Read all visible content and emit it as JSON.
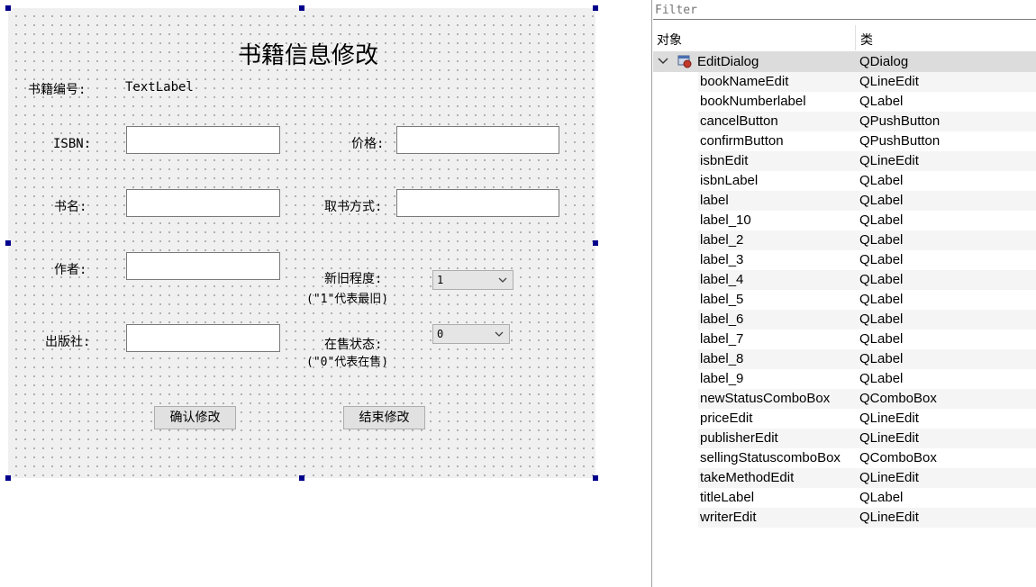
{
  "form": {
    "title": "书籍信息修改",
    "book_number_label": "书籍编号:",
    "book_number_value": "TextLabel",
    "isbn_label": "ISBN:",
    "price_label": "价格:",
    "book_name_label": "书名:",
    "take_method_label": "取书方式:",
    "writer_label": "作者:",
    "condition_label": "新旧程度:",
    "condition_hint": "(\"1\"代表最旧)",
    "condition_value": "1",
    "publisher_label": "出版社:",
    "selling_label": "在售状态:",
    "selling_hint": "(\"0\"代表在售)",
    "selling_value": "0",
    "confirm_button": "确认修改",
    "cancel_button": "结束修改"
  },
  "inspector": {
    "filter_placeholder": "Filter",
    "col_object": "对象",
    "col_class": "类",
    "root": {
      "name": "EditDialog",
      "class": "QDialog"
    },
    "rows": [
      {
        "name": "bookNameEdit",
        "class": "QLineEdit"
      },
      {
        "name": "bookNumberlabel",
        "class": "QLabel"
      },
      {
        "name": "cancelButton",
        "class": "QPushButton"
      },
      {
        "name": "confirmButton",
        "class": "QPushButton"
      },
      {
        "name": "isbnEdit",
        "class": "QLineEdit"
      },
      {
        "name": "isbnLabel",
        "class": "QLabel"
      },
      {
        "name": "label",
        "class": "QLabel"
      },
      {
        "name": "label_10",
        "class": "QLabel"
      },
      {
        "name": "label_2",
        "class": "QLabel"
      },
      {
        "name": "label_3",
        "class": "QLabel"
      },
      {
        "name": "label_4",
        "class": "QLabel"
      },
      {
        "name": "label_5",
        "class": "QLabel"
      },
      {
        "name": "label_6",
        "class": "QLabel"
      },
      {
        "name": "label_7",
        "class": "QLabel"
      },
      {
        "name": "label_8",
        "class": "QLabel"
      },
      {
        "name": "label_9",
        "class": "QLabel"
      },
      {
        "name": "newStatusComboBox",
        "class": "QComboBox"
      },
      {
        "name": "priceEdit",
        "class": "QLineEdit"
      },
      {
        "name": "publisherEdit",
        "class": "QLineEdit"
      },
      {
        "name": "sellingStatuscomboBox",
        "class": "QComboBox"
      },
      {
        "name": "takeMethodEdit",
        "class": "QLineEdit"
      },
      {
        "name": "titleLabel",
        "class": "QLabel"
      },
      {
        "name": "writerEdit",
        "class": "QLineEdit"
      }
    ]
  }
}
